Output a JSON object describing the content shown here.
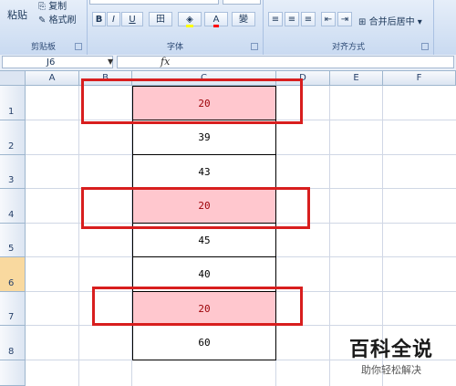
{
  "ribbon": {
    "clipboard": {
      "paste": "粘贴",
      "copy": "复制",
      "format_painter": "格式刷",
      "label": "剪贴板"
    },
    "font": {
      "label": "字体",
      "bold": "B",
      "italic": "I",
      "underline": "U",
      "border": "田",
      "font_color": "A",
      "wen": "變"
    },
    "alignment": {
      "label": "对齐方式",
      "merge_center": "合并后居中"
    }
  },
  "formula_bar": {
    "name_box": "J6",
    "fx": "fx"
  },
  "columns": [
    "A",
    "B",
    "C",
    "D",
    "E",
    "F"
  ],
  "rows": [
    "1",
    "2",
    "3",
    "4",
    "5",
    "6",
    "7",
    "8"
  ],
  "active_row": "6",
  "cells_c": [
    "20",
    "39",
    "43",
    "20",
    "45",
    "40",
    "20",
    "60"
  ],
  "highlight_color": "#ffc7ce",
  "highlight_text_color": "#9c0006",
  "watermark": {
    "title": "百科全说",
    "subtitle": "助你轻松解决"
  }
}
